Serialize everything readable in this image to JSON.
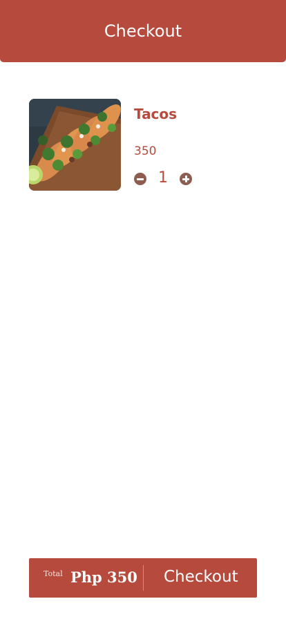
{
  "header": {
    "title": "Checkout"
  },
  "cart": {
    "items": [
      {
        "name": "Tacos",
        "price": "350",
        "quantity": "1",
        "image_icon": "tacos-photo"
      }
    ]
  },
  "checkout_bar": {
    "total_label": "Total",
    "total_amount": "Php 350",
    "button_label": "Checkout"
  },
  "colors": {
    "primary": "#b54a3d",
    "qty_button": "#8d5e4f",
    "background": "#ffffff"
  }
}
